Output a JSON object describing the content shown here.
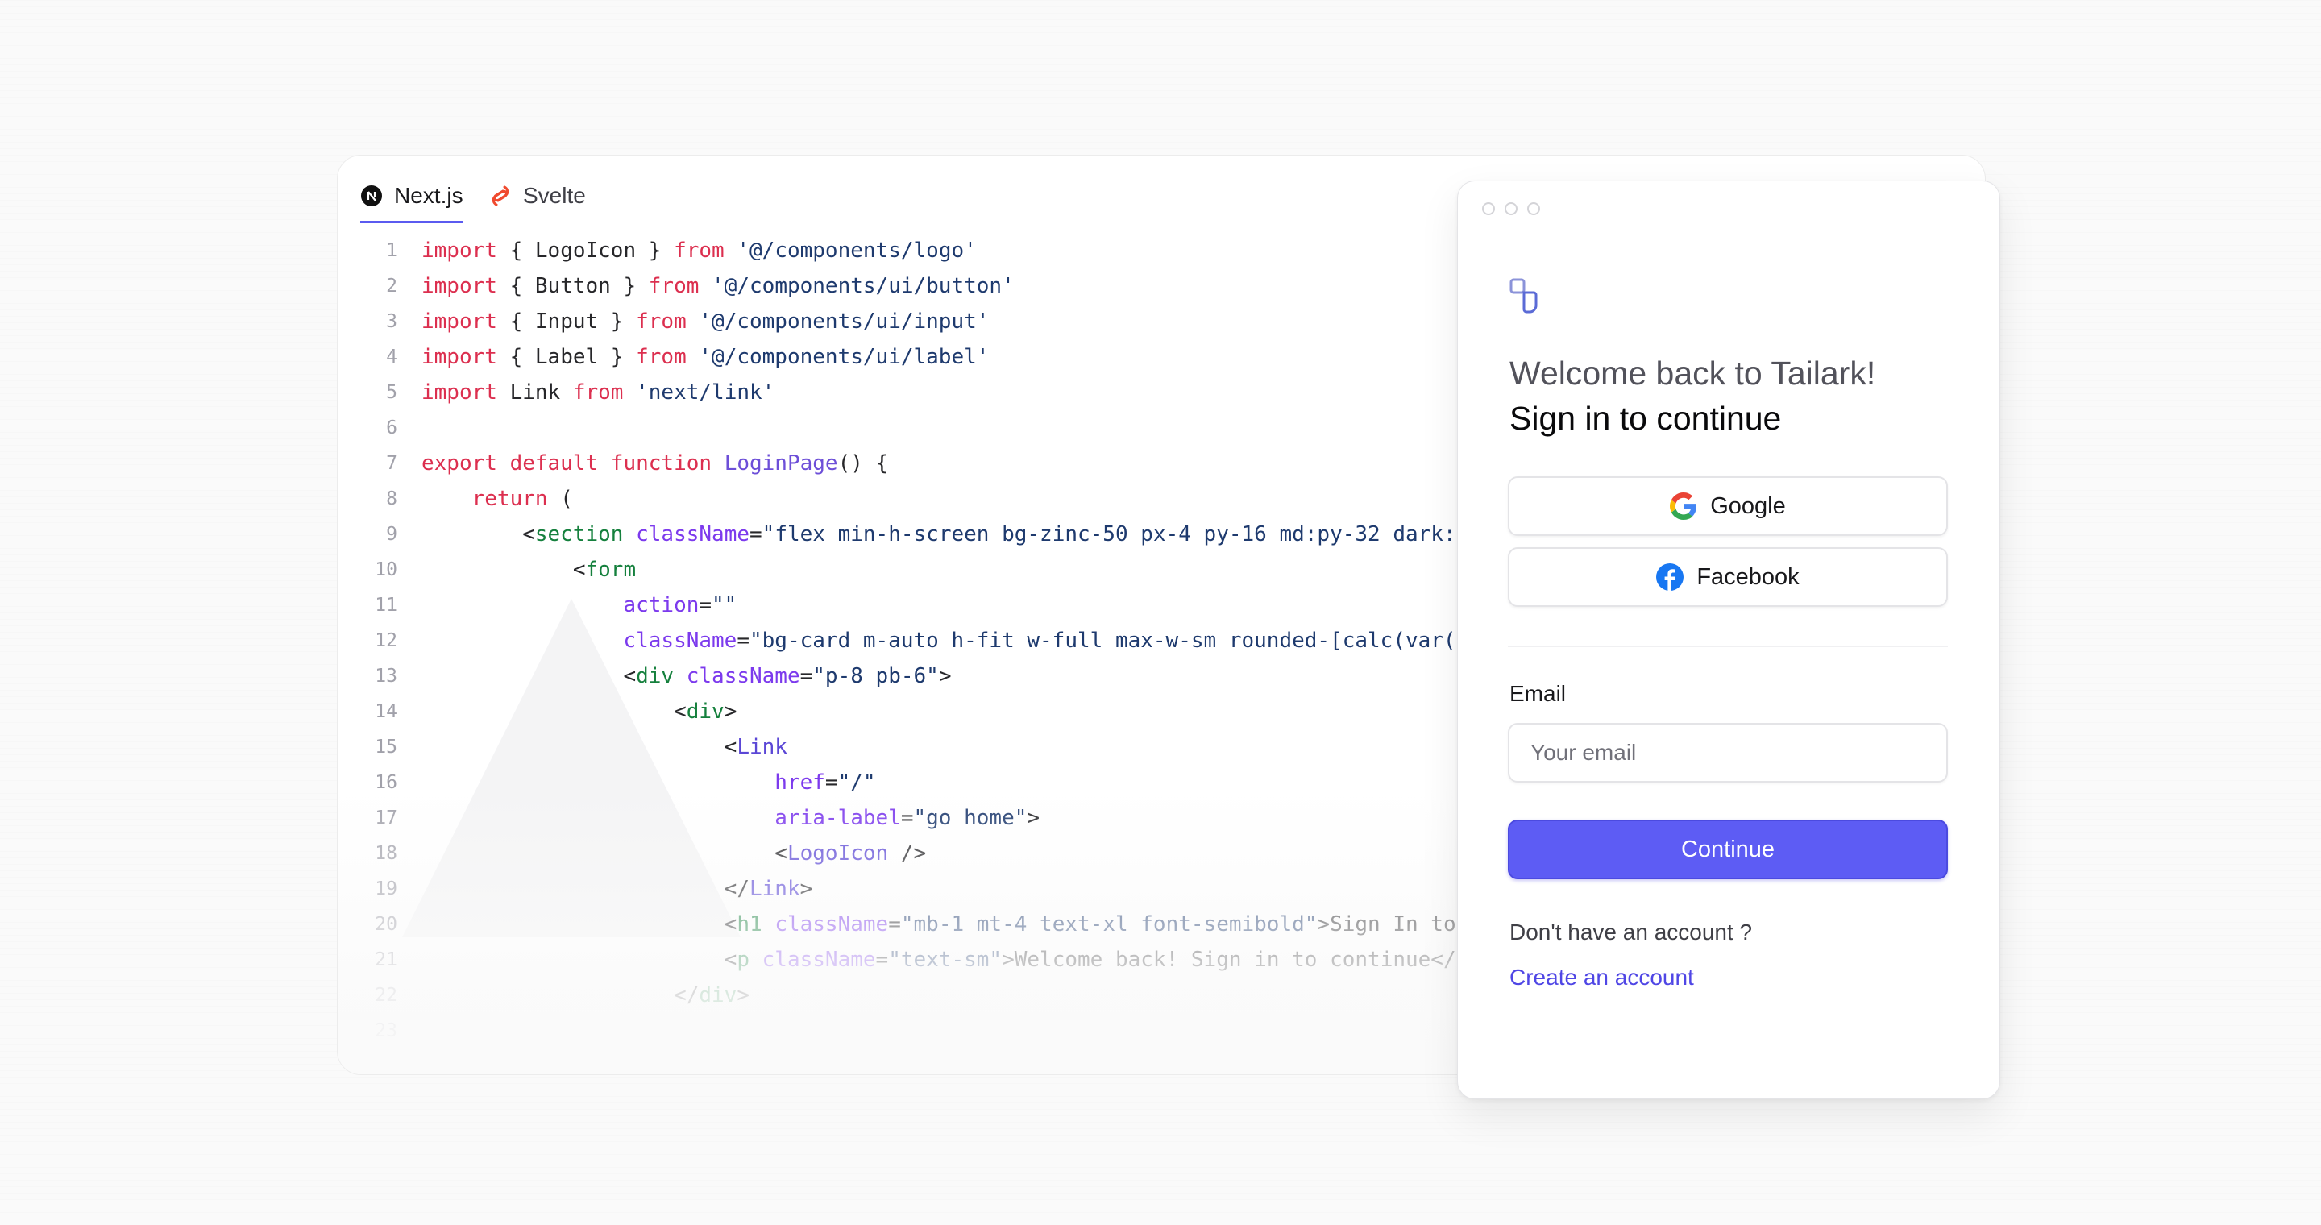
{
  "editor": {
    "tabs": [
      {
        "label": "Next.js",
        "icon": "nextjs-icon",
        "active": true
      },
      {
        "label": "Svelte",
        "icon": "svelte-icon",
        "active": false
      }
    ],
    "lines": [
      {
        "num": "1",
        "tokens": [
          [
            "kw",
            "import"
          ],
          [
            "plain",
            " { LogoIcon } "
          ],
          [
            "kw",
            "from"
          ],
          [
            "plain",
            " "
          ],
          [
            "str",
            "'@/components/logo'"
          ]
        ]
      },
      {
        "num": "2",
        "tokens": [
          [
            "kw",
            "import"
          ],
          [
            "plain",
            " { Button } "
          ],
          [
            "kw",
            "from"
          ],
          [
            "plain",
            " "
          ],
          [
            "str",
            "'@/components/ui/button'"
          ]
        ]
      },
      {
        "num": "3",
        "tokens": [
          [
            "kw",
            "import"
          ],
          [
            "plain",
            " { Input } "
          ],
          [
            "kw",
            "from"
          ],
          [
            "plain",
            " "
          ],
          [
            "str",
            "'@/components/ui/input'"
          ]
        ]
      },
      {
        "num": "4",
        "tokens": [
          [
            "kw",
            "import"
          ],
          [
            "plain",
            " { Label } "
          ],
          [
            "kw",
            "from"
          ],
          [
            "plain",
            " "
          ],
          [
            "str",
            "'@/components/ui/label'"
          ]
        ]
      },
      {
        "num": "5",
        "tokens": [
          [
            "kw",
            "import"
          ],
          [
            "plain",
            " Link "
          ],
          [
            "kw",
            "from"
          ],
          [
            "plain",
            " "
          ],
          [
            "str",
            "'next/link'"
          ]
        ]
      },
      {
        "num": "6",
        "tokens": []
      },
      {
        "num": "7",
        "tokens": [
          [
            "kw",
            "export default function"
          ],
          [
            "plain",
            " "
          ],
          [
            "fn",
            "LoginPage"
          ],
          [
            "plain",
            "() {"
          ]
        ]
      },
      {
        "num": "8",
        "tokens": [
          [
            "plain",
            "    "
          ],
          [
            "kw",
            "return"
          ],
          [
            "plain",
            " ("
          ]
        ]
      },
      {
        "num": "9",
        "tokens": [
          [
            "plain",
            "        <"
          ],
          [
            "tag",
            "section"
          ],
          [
            "plain",
            " "
          ],
          [
            "attr",
            "className"
          ],
          [
            "plain",
            "="
          ],
          [
            "str",
            "\"flex min-h-screen bg-zinc-50 px-4 py-16 md:py-32 dark:"
          ]
        ]
      },
      {
        "num": "10",
        "tokens": [
          [
            "plain",
            "            <"
          ],
          [
            "tag",
            "form"
          ]
        ]
      },
      {
        "num": "11",
        "tokens": [
          [
            "plain",
            "                "
          ],
          [
            "attr",
            "action"
          ],
          [
            "plain",
            "="
          ],
          [
            "str",
            "\"\""
          ]
        ]
      },
      {
        "num": "12",
        "tokens": [
          [
            "plain",
            "                "
          ],
          [
            "attr",
            "className"
          ],
          [
            "plain",
            "="
          ],
          [
            "str",
            "\"bg-card m-auto h-fit w-full max-w-sm rounded-[calc(var("
          ]
        ]
      },
      {
        "num": "13",
        "tokens": [
          [
            "plain",
            "                <"
          ],
          [
            "tag",
            "div"
          ],
          [
            "plain",
            " "
          ],
          [
            "attr",
            "className"
          ],
          [
            "plain",
            "="
          ],
          [
            "str",
            "\"p-8 pb-6\""
          ],
          [
            "plain",
            ">"
          ]
        ]
      },
      {
        "num": "14",
        "tokens": [
          [
            "plain",
            "                    <"
          ],
          [
            "tag",
            "div"
          ],
          [
            "plain",
            ">"
          ]
        ]
      },
      {
        "num": "15",
        "tokens": [
          [
            "plain",
            "                        <"
          ],
          [
            "tag2",
            "Link"
          ]
        ]
      },
      {
        "num": "16",
        "tokens": [
          [
            "plain",
            "                            "
          ],
          [
            "attr",
            "href"
          ],
          [
            "plain",
            "="
          ],
          [
            "str",
            "\"/\""
          ]
        ]
      },
      {
        "num": "17",
        "tokens": [
          [
            "plain",
            "                            "
          ],
          [
            "attr",
            "aria-label"
          ],
          [
            "plain",
            "="
          ],
          [
            "str",
            "\"go home\""
          ],
          [
            "plain",
            ">"
          ]
        ]
      },
      {
        "num": "18",
        "tokens": [
          [
            "plain",
            "                            <"
          ],
          [
            "tag2",
            "LogoIcon"
          ],
          [
            "plain",
            " />"
          ]
        ]
      },
      {
        "num": "19",
        "tokens": [
          [
            "plain",
            "                        </"
          ],
          [
            "tag2",
            "Link"
          ],
          [
            "plain",
            ">"
          ]
        ]
      },
      {
        "num": "20",
        "tokens": [
          [
            "plain",
            "                        <"
          ],
          [
            "tag",
            "h1"
          ],
          [
            "plain",
            " "
          ],
          [
            "attr",
            "className"
          ],
          [
            "plain",
            "="
          ],
          [
            "str",
            "\"mb-1 mt-4 text-xl font-semibold\""
          ],
          [
            "plain",
            ">Sign In to"
          ]
        ]
      },
      {
        "num": "21",
        "tokens": [
          [
            "plain",
            "                        <"
          ],
          [
            "tag",
            "p"
          ],
          [
            "plain",
            " "
          ],
          [
            "attr",
            "className"
          ],
          [
            "plain",
            "="
          ],
          [
            "str",
            "\"text-sm\""
          ],
          [
            "plain",
            ">Welcome back! Sign in to continue</"
          ]
        ]
      },
      {
        "num": "22",
        "tokens": [
          [
            "plain",
            "                    </"
          ],
          [
            "tag",
            "div"
          ],
          [
            "plain",
            ">"
          ]
        ]
      },
      {
        "num": "23",
        "tokens": []
      }
    ]
  },
  "login": {
    "logo_icon": "tailark-logo-icon",
    "welcome": "Welcome back to Tailark!",
    "subtitle": "Sign in to continue",
    "google_label": "Google",
    "facebook_label": "Facebook",
    "email_label": "Email",
    "email_placeholder": "Your email",
    "email_value": "",
    "continue_label": "Continue",
    "no_account": "Don't have an account ?",
    "create_account": "Create an account",
    "accent": "#5d5cf4"
  }
}
